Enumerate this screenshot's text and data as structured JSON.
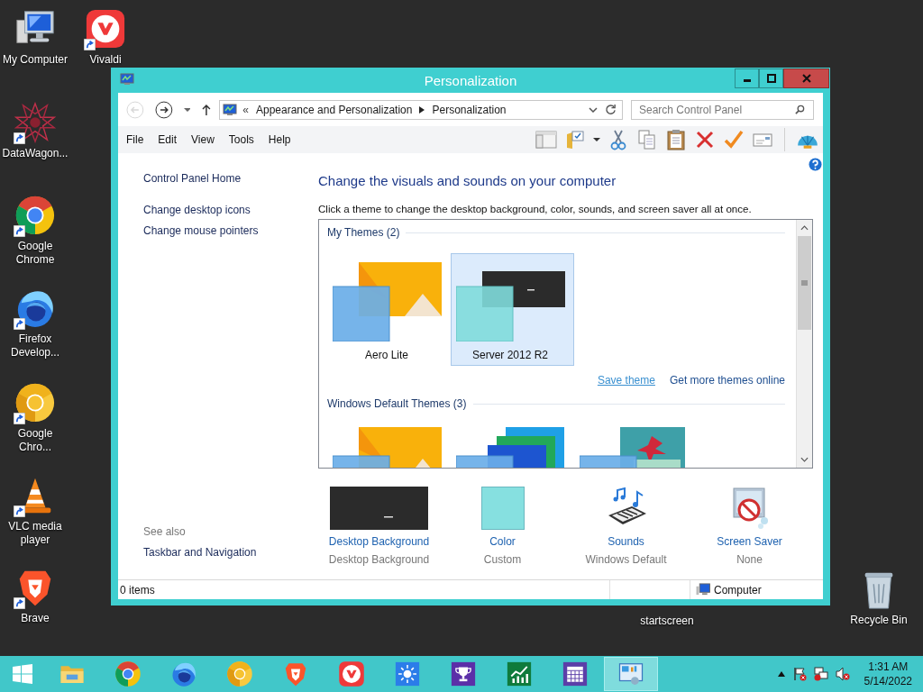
{
  "desktop_icons": [
    {
      "label": "My Computer",
      "kind": "computer",
      "shortcut": false
    },
    {
      "label": "Vivaldi",
      "kind": "vivaldi",
      "shortcut": true
    },
    {
      "label": "DataWagon...",
      "kind": "datawagon",
      "shortcut": true
    },
    {
      "label": "Google Chrome",
      "kind": "chrome",
      "shortcut": true
    },
    {
      "label": "Firefox Develop...",
      "kind": "firefox",
      "shortcut": true
    },
    {
      "label": "Google Chro...",
      "kind": "canary",
      "shortcut": true
    },
    {
      "label": "VLC media player",
      "kind": "vlc",
      "shortcut": true
    },
    {
      "label": "Brave",
      "kind": "brave",
      "shortcut": true
    },
    {
      "label": "startscreen",
      "kind": "hidden",
      "shortcut": false
    },
    {
      "label": "Recycle Bin",
      "kind": "recycle",
      "shortcut": false
    }
  ],
  "window": {
    "title": "Personalization",
    "back": {
      "disabled": true
    },
    "forward": {
      "disabled": false
    },
    "address": {
      "overflow": "«",
      "crumbs": [
        "Appearance and Personalization",
        "Personalization"
      ]
    },
    "search": {
      "placeholder": "Search Control Panel"
    },
    "menu": [
      "File",
      "Edit",
      "View",
      "Tools",
      "Help"
    ],
    "left_pane": {
      "links": [
        "Control Panel Home",
        "Change desktop icons",
        "Change mouse pointers"
      ],
      "see_also": {
        "title": "See also",
        "links": [
          "Taskbar and Navigation"
        ]
      }
    },
    "heading": "Change the visuals and sounds on your computer",
    "subheading": "Click a theme to change the desktop background, color, sounds, and screen saver all at once.",
    "theme_groups": [
      {
        "title": "My Themes (2)",
        "themes": [
          {
            "name": "Aero Lite",
            "kind": "aero",
            "selected": false
          },
          {
            "name": "Server 2012 R2",
            "kind": "server",
            "selected": true
          }
        ],
        "links": [
          {
            "label": "Save theme",
            "hovered": true
          },
          {
            "label": "Get more themes online",
            "hovered": false
          }
        ]
      },
      {
        "title": "Windows Default Themes (3)",
        "themes": [
          {
            "kind": "windows",
            "selected": false
          },
          {
            "kind": "panes",
            "selected": false
          },
          {
            "kind": "flowers",
            "selected": false
          }
        ]
      }
    ],
    "settings": [
      {
        "label": "Desktop Background",
        "value": "Desktop Background",
        "kind": "background"
      },
      {
        "label": "Color",
        "value": "Custom",
        "kind": "color"
      },
      {
        "label": "Sounds",
        "value": "Windows Default",
        "kind": "sounds"
      },
      {
        "label": "Screen Saver",
        "value": "None",
        "kind": "screensaver"
      }
    ],
    "status_bar": {
      "items": "0 items",
      "location": "Computer"
    }
  },
  "taskbar": {
    "apps": [
      {
        "kind": "explorer",
        "selected": false
      },
      {
        "kind": "chrome",
        "selected": false
      },
      {
        "kind": "firefox",
        "selected": false
      },
      {
        "kind": "canary",
        "selected": false
      },
      {
        "kind": "brave",
        "selected": false
      },
      {
        "kind": "vivaldi",
        "selected": false
      },
      {
        "kind": "weather",
        "selected": false
      },
      {
        "kind": "trophy",
        "selected": false
      },
      {
        "kind": "chart",
        "selected": false
      },
      {
        "kind": "calendar",
        "selected": false
      },
      {
        "kind": "control",
        "selected": true
      }
    ],
    "clock": {
      "time": "1:31 AM",
      "date": "5/14/2022"
    }
  }
}
